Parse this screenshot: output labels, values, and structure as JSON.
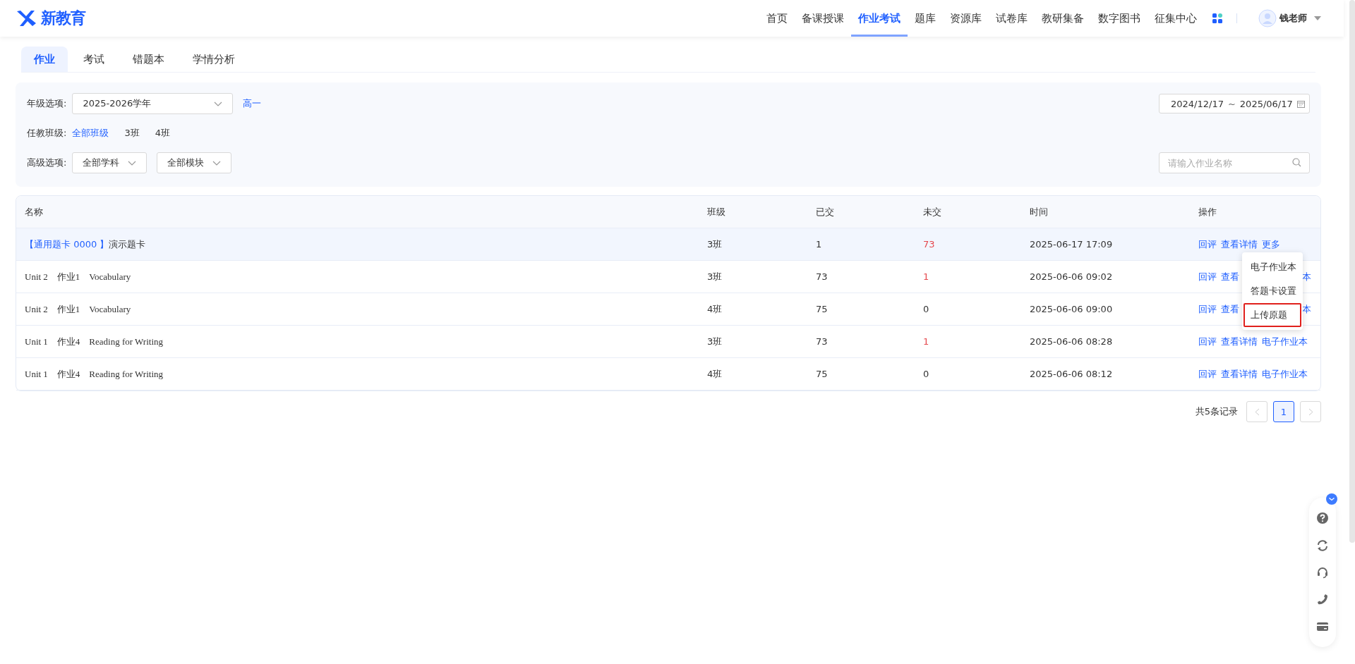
{
  "header": {
    "logo_text": "新教育",
    "nav": [
      {
        "label": "首页",
        "selected": false
      },
      {
        "label": "备课授课",
        "selected": false
      },
      {
        "label": "作业考试",
        "selected": true
      },
      {
        "label": "题库",
        "selected": false
      },
      {
        "label": "资源库",
        "selected": false
      },
      {
        "label": "试卷库",
        "selected": false
      },
      {
        "label": "教研集备",
        "selected": false
      },
      {
        "label": "数字图书",
        "selected": false
      },
      {
        "label": "征集中心",
        "selected": false
      }
    ],
    "user": "钱老师"
  },
  "tabs": [
    {
      "label": "作业",
      "selected": true
    },
    {
      "label": "考试",
      "selected": false
    },
    {
      "label": "错题本",
      "selected": false
    },
    {
      "label": "学情分析",
      "selected": false
    }
  ],
  "filters": {
    "grade_label": "年级选项:",
    "school_year": "2025-2026学年",
    "grade": "高一",
    "class_label": "任教班级:",
    "classes": [
      {
        "label": "全部班级",
        "selected": true
      },
      {
        "label": "3班",
        "selected": false
      },
      {
        "label": "4班",
        "selected": false
      }
    ],
    "advanced_label": "高级选项:",
    "subject": "全部学科",
    "module": "全部模块",
    "date_start": "2024/12/17",
    "date_sep": "~",
    "date_end": "2025/06/17",
    "search": {
      "placeholder": "请输入作业名称"
    }
  },
  "table": {
    "columns": [
      "名称",
      "班级",
      "已交",
      "未交",
      "时间",
      "操作"
    ],
    "rows": [
      {
        "tag": "【通用题卡 0000 】",
        "name": "演示题卡",
        "class": "3班",
        "submitted": "1",
        "unsubmitted": "73",
        "unsubmitted_alert": true,
        "time": "2025-06-17 17:09",
        "hovered": true,
        "covered": false,
        "actions": [
          "回评",
          "查看详情",
          "更多"
        ]
      },
      {
        "name": "Unit 2　作业1　Vocabulary",
        "class": "3班",
        "submitted": "73",
        "unsubmitted": "1",
        "unsubmitted_alert": true,
        "time": "2025-06-06 09:02",
        "hovered": false,
        "covered": true,
        "actions": [
          "回评",
          "查看",
          "本"
        ]
      },
      {
        "name": "Unit 2　作业1　Vocabulary",
        "class": "4班",
        "submitted": "75",
        "unsubmitted": "0",
        "unsubmitted_alert": false,
        "time": "2025-06-06 09:00",
        "hovered": false,
        "covered": true,
        "actions": [
          "回评",
          "查看",
          "本"
        ]
      },
      {
        "name": "Unit 1　作业4　Reading for Writing",
        "class": "3班",
        "submitted": "73",
        "unsubmitted": "1",
        "unsubmitted_alert": true,
        "time": "2025-06-06 08:28",
        "hovered": false,
        "covered": false,
        "actions": [
          "回评",
          "查看详情",
          "电子作业本"
        ]
      },
      {
        "name": "Unit 1　作业4　Reading for Writing",
        "class": "4班",
        "submitted": "75",
        "unsubmitted": "0",
        "unsubmitted_alert": false,
        "time": "2025-06-06 08:12",
        "hovered": false,
        "covered": false,
        "actions": [
          "回评",
          "查看详情",
          "电子作业本"
        ]
      }
    ]
  },
  "more_menu": {
    "items": [
      {
        "label": "电子作业本",
        "highlighted": false
      },
      {
        "label": "答题卡设置",
        "highlighted": false
      },
      {
        "label": "上传原题",
        "highlighted": true
      }
    ]
  },
  "pagination": {
    "total": "共5条记录",
    "pages": [
      {
        "label": "1",
        "selected": true
      }
    ]
  }
}
